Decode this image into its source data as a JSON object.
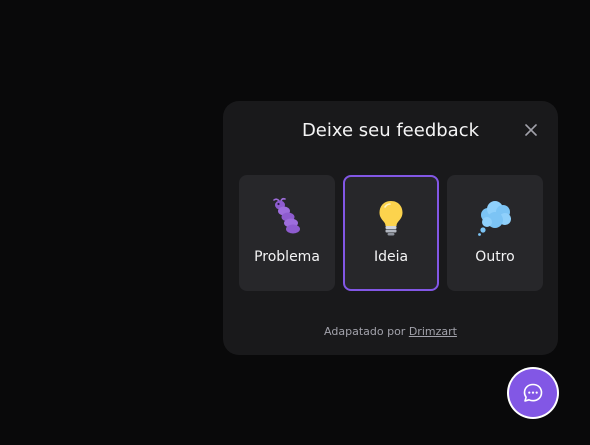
{
  "widget": {
    "title": "Deixe seu feedback",
    "close_icon": "close-icon",
    "options": [
      {
        "label": "Problema",
        "icon": "bug-icon"
      },
      {
        "label": "Ideia",
        "icon": "lightbulb-icon",
        "selected": true
      },
      {
        "label": "Outro",
        "icon": "thought-bubble-icon"
      }
    ],
    "footer": {
      "prefix": "Adapatado por",
      "link_label": "Drimzart"
    }
  },
  "launcher": {
    "icon": "chat-bubble-icon"
  },
  "colors": {
    "page_background": "#09090a",
    "panel_background": "#19191b",
    "card_background": "#27272a",
    "accent": "#8257e5",
    "text_primary": "#f4f4f5",
    "text_secondary": "#a1a1aa"
  }
}
